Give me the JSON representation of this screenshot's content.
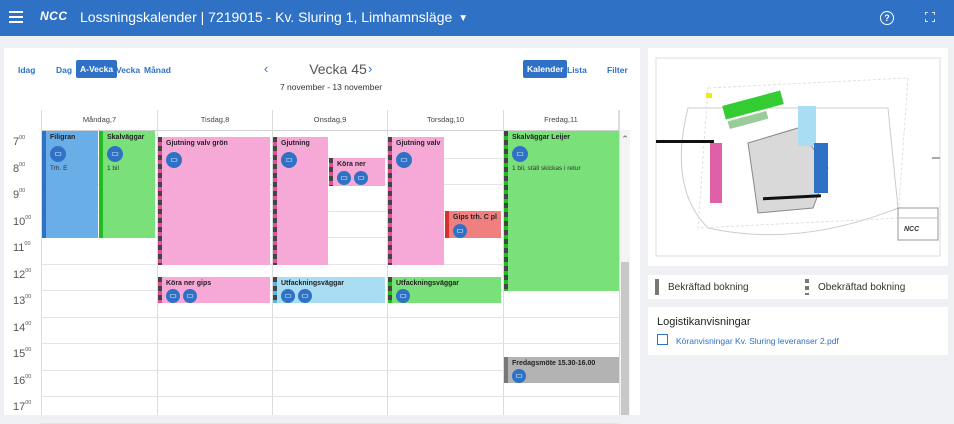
{
  "header": {
    "logo": "NCC",
    "title": "Lossningskalender  |  7219015 - Kv. Sluring 1, Limhamnsläge",
    "menu_icon": "hamburger-icon",
    "help_icon": "help-icon",
    "expand_icon": "fullscreen-icon"
  },
  "toolbar": {
    "today": "Idag",
    "views": [
      "Dag",
      "A-Vecka",
      "Vecka",
      "Månad"
    ],
    "active_view": "A-Vecka",
    "week_title": "Vecka 45",
    "week_range": "7 november - 13 november",
    "modes": [
      "Kalender",
      "Lista"
    ],
    "active_mode": "Kalender",
    "filter": "Filter"
  },
  "calendar": {
    "days": [
      "Måndag,7",
      "Tisdag,8",
      "Onsdag,9",
      "Torsdag,10",
      "Fredag,11"
    ],
    "hours": [
      "7",
      "8",
      "9",
      "10",
      "11",
      "12",
      "13",
      "14",
      "15",
      "16",
      "17"
    ],
    "hour_suffix": "00",
    "events": [
      {
        "title": "Filigran",
        "detail": "Trh. E",
        "color": "#6aaee8",
        "stripe": "#2f72c5"
      },
      {
        "title": "Skalväggar",
        "detail": "1 bil",
        "color": "#7ae07a",
        "stripe": "#22bb22"
      },
      {
        "title": "Gjutning valv grön",
        "detail": "",
        "color": "#f6a8d6",
        "stripe": "#e0509a"
      },
      {
        "title": "Köra ner gips",
        "detail": "",
        "color": "#f6a8d6",
        "stripe": "#e0509a"
      },
      {
        "title": "Gjutning",
        "detail": "",
        "color": "#f6a8d6",
        "stripe": "#e0509a"
      },
      {
        "title": "Köra ner",
        "detail": "",
        "color": "#f6a8d6",
        "stripe": "#e0509a"
      },
      {
        "title": "Utfackningsväggar",
        "detail": "",
        "color": "#a8ddf4",
        "stripe": "#5bb5e0"
      },
      {
        "title": "Gjutning valv",
        "detail": "",
        "color": "#f6a8d6",
        "stripe": "#e0509a"
      },
      {
        "title": "Gips trh. C pl",
        "detail": "",
        "color": "#f08080",
        "stripe": "#d9302f"
      },
      {
        "title": "Utfackningsväggar",
        "detail": "",
        "color": "#7ae07a",
        "stripe": "#22bb22"
      },
      {
        "title": "Skalväggar Leijer",
        "detail": "1 bil, ställ skickas i retur",
        "color": "#7ae07a",
        "stripe": "#22bb22"
      },
      {
        "title": "Fredagsmöte 15.30-16.00",
        "detail": "",
        "color": "#b3b3b3",
        "stripe": "#777777"
      }
    ]
  },
  "legend": {
    "confirmed": "Bekräftad bokning",
    "unconfirmed": "Obekräftad bokning"
  },
  "logistics": {
    "heading": "Logistikanvisningar",
    "link_text": "Köranvisningar Kv. Sluring leveranser 2.pdf",
    "link_icon": "external-link-icon"
  },
  "map": {
    "stamp_logo": "NCC"
  }
}
